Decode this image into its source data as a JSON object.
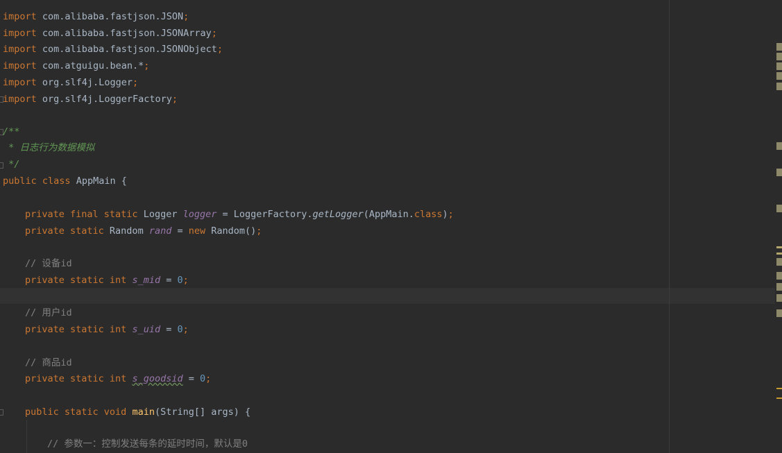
{
  "code": {
    "l1": {
      "kw": "import",
      "rest": " com.alibaba.fastjson.JSON",
      "semi": ";"
    },
    "l2": {
      "kw": "import",
      "rest": " com.alibaba.fastjson.JSONArray",
      "semi": ";"
    },
    "l3": {
      "kw": "import",
      "rest": " com.alibaba.fastjson.JSONObject",
      "semi": ";"
    },
    "l4": {
      "kw": "import",
      "rest": " com.atguigu.bean.*",
      "semi": ";"
    },
    "l5": {
      "kw": "import",
      "rest": " org.slf4j.Logger",
      "semi": ";"
    },
    "l6": {
      "kw": "import",
      "rest": " org.slf4j.LoggerFactory",
      "semi": ";"
    },
    "l7": {
      "doc": "/**"
    },
    "l8": {
      "doc": " * 日志行为数据模拟"
    },
    "l9": {
      "doc": " */"
    },
    "l10": {
      "kw1": "public",
      "kw2": "class",
      "name": " AppMain {"
    },
    "l11": {
      "kw": "private final static",
      "type": " Logger ",
      "field": "logger",
      "eq": " = LoggerFactory.",
      "call": "getLogger",
      "arg": "(AppMain.",
      "cls": "class",
      "end": ")",
      "semi": ";"
    },
    "l12": {
      "kw": "private static",
      "type": " Random ",
      "field": "rand",
      "eq": " = ",
      "new": "new",
      "ctor": " Random()",
      "semi": ";"
    },
    "l13": {
      "comment": "// 设备id"
    },
    "l14": {
      "kw": "private static int",
      "field": "s_mid",
      "eq": " = ",
      "num": "0",
      "semi": ";"
    },
    "l15": {
      "comment": "// 用户id"
    },
    "l16": {
      "kw": "private static int",
      "field": "s_uid",
      "eq": " = ",
      "num": "0",
      "semi": ";"
    },
    "l17": {
      "comment": "// 商品id"
    },
    "l18": {
      "kw": "private static int",
      "field": "s_goodsid",
      "eq": " = ",
      "num": "0",
      "semi": ";"
    },
    "l19": {
      "kw": "public static void",
      "method": "main",
      "params": "(String[] args) {"
    },
    "l20": {
      "comment": "// 参数一：控制发送每条的延时时间，默认是0"
    }
  },
  "colors": {
    "background": "#2b2b2b",
    "keyword": "#cc7832",
    "field": "#9876aa",
    "method": "#ffc66d",
    "number": "#6897bb",
    "doc": "#629755",
    "comment": "#808080"
  }
}
